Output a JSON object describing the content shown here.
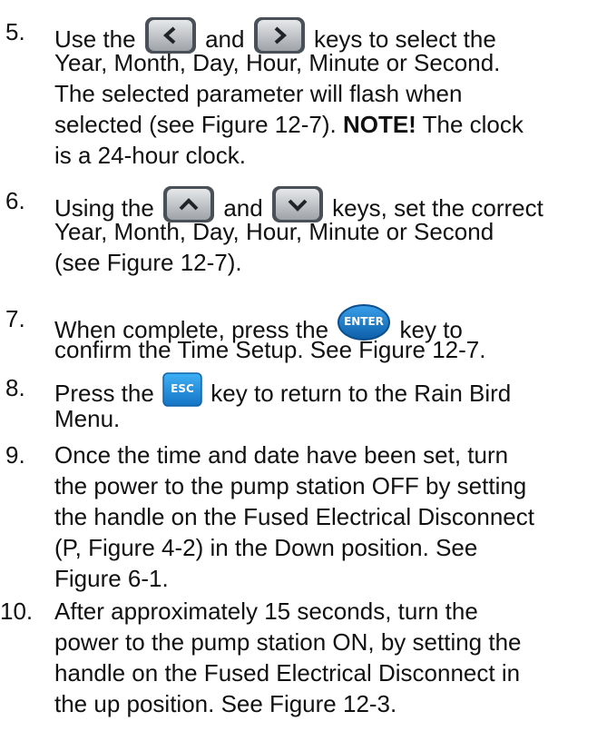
{
  "steps": [
    {
      "number": "5.",
      "l1a": "Use the",
      "l1b": "and",
      "l1c": "keys to select the",
      "l2": "Year, Month, Day, Hour, Minute or Second.",
      "l3": "The selected parameter will flash when",
      "l4a": "selected (see Figure 12-7).",
      "l4note": "NOTE!",
      "l4b": "The clock",
      "l5": "is a 24-hour clock.",
      "icons": [
        "left-arrow-key",
        "right-arrow-key"
      ]
    },
    {
      "number": "6.",
      "l1a": "Using the",
      "l1b": "and",
      "l1c": "keys, set the correct",
      "l2": "Year, Month, Day, Hour, Minute or Second",
      "l3": "(see Figure 12-7).",
      "icons": [
        "up-arrow-key",
        "down-arrow-key"
      ]
    },
    {
      "number": "7.",
      "l1a": "When complete, press the",
      "l1b": "key to",
      "l2": "confirm the Time Setup.  See Figure 12-7.",
      "key_label": "ENTER"
    },
    {
      "number": "8.",
      "l1a": "Press the",
      "l1b": "key to return to the Rain Bird",
      "l2": "Menu.",
      "key_label": "ESC"
    },
    {
      "number": "9.",
      "lines": [
        "Once the time and date have been set, turn",
        "the power to the pump station OFF by setting",
        "the handle on the Fused Electrical Disconnect",
        "(P, Figure 4-2) in the Down position.  See",
        "Figure 6-1."
      ]
    },
    {
      "number": "10.",
      "lines": [
        "After approximately 15 seconds, turn the",
        "power to the pump station ON, by setting the",
        "handle on the Fused Electrical Disconnect in",
        "the up position.  See Figure 12-3."
      ]
    }
  ],
  "colors": {
    "key_gray": "#b8bcc0",
    "key_dark": "#4a5058",
    "enter_blue": "#1577c8",
    "esc_blue": "#1b8be0"
  }
}
